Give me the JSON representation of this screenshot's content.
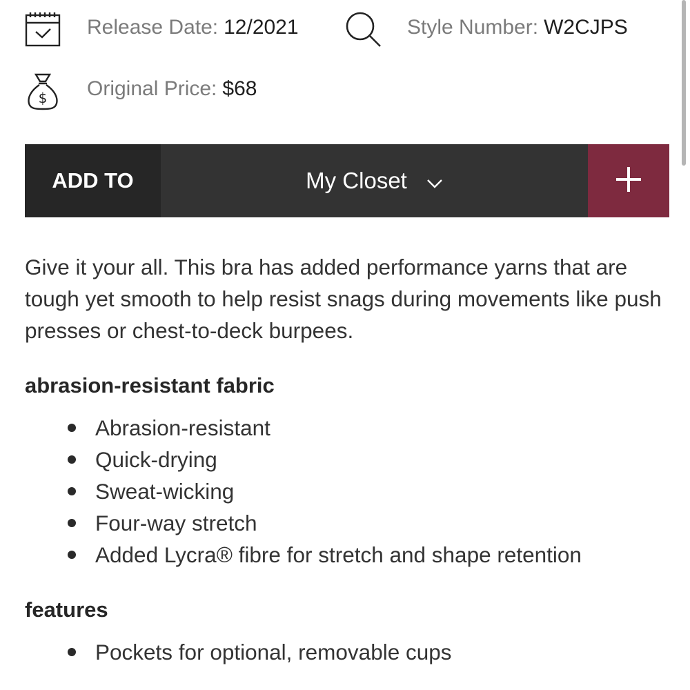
{
  "details": {
    "release": {
      "label": "Release Date:",
      "value": "12/2021",
      "icon": "calendar-check-icon"
    },
    "style": {
      "label": "Style Number:",
      "value": "W2CJPS",
      "icon": "search-icon"
    },
    "price": {
      "label": "Original Price:",
      "value": "$68",
      "icon": "money-bag-icon"
    }
  },
  "add_to": {
    "label": "ADD TO",
    "selected_closet": "My Closet",
    "plus_symbol": "+"
  },
  "description": "Give it your all. This bra has added performance yarns that are tough yet smooth to help resist snags during movements like push presses or chest-to-deck burpees.",
  "sections": [
    {
      "heading": "abrasion-resistant fabric",
      "items": [
        "Abrasion-resistant",
        "Quick-drying",
        "Sweat-wicking",
        "Four-way stretch",
        "Added Lycra® fibre for stretch and shape retention"
      ]
    },
    {
      "heading": "features",
      "items": [
        "Pockets for optional, removable cups"
      ]
    }
  ],
  "colors": {
    "accent": "#7e2a3f",
    "bar_dark": "#262626",
    "bar_mid": "#333333"
  }
}
